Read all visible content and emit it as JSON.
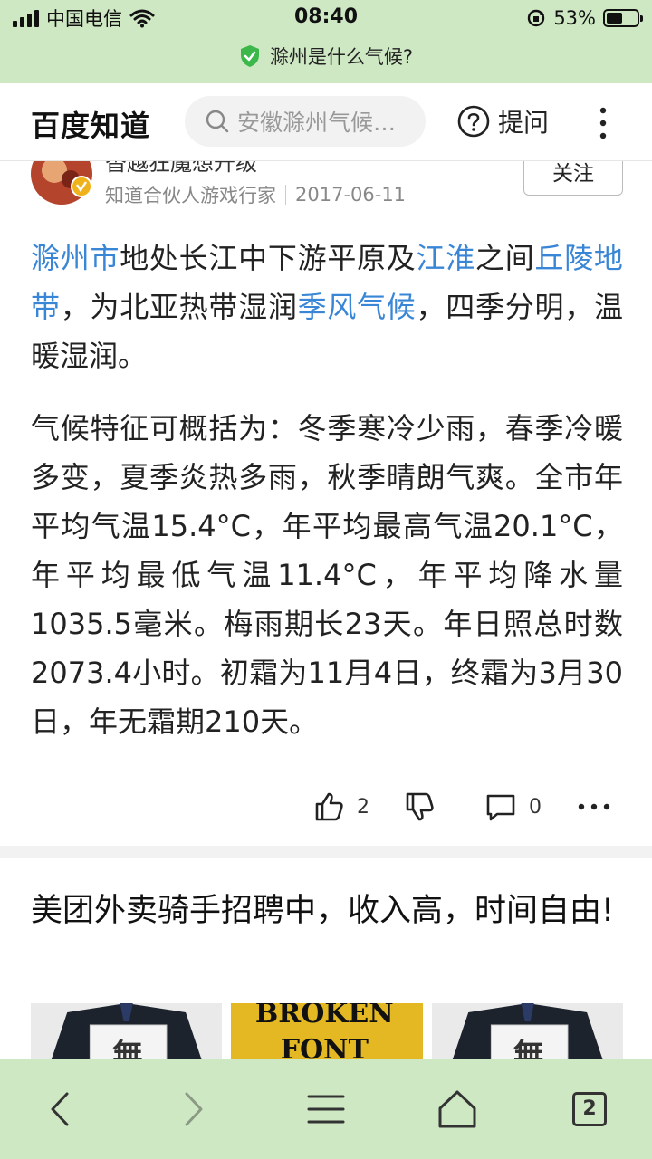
{
  "status_bar": {
    "carrier": "中国电信",
    "time": "08:40",
    "battery_text": "53%",
    "battery_level": 0.53
  },
  "url_bar": {
    "page_title": "滁州是什么气候?",
    "secure_icon": "shield-check-icon"
  },
  "header": {
    "logo": "百度知道",
    "search_placeholder": "安徽滁州气候…",
    "ask_label": "提问"
  },
  "answer": {
    "author_name": "杳越狂魔想升级",
    "author_role": "知道合伙人游戏行家",
    "date": "2017-06-11",
    "follow_label": "关注",
    "para1": [
      {
        "t": "滁州市",
        "link": true
      },
      {
        "t": "地处长江中下游平原及",
        "link": false
      },
      {
        "t": "江淮",
        "link": true
      },
      {
        "t": "之间",
        "link": false
      },
      {
        "t": "丘陵地带",
        "link": true
      },
      {
        "t": "，为北亚热带湿润",
        "link": false
      },
      {
        "t": "季风气候",
        "link": true
      },
      {
        "t": "，四季分明，温暖湿润。",
        "link": false
      }
    ],
    "para2": "气候特征可概括为：冬季寒冷少雨，春季冷暖多变，夏季炎热多雨，秋季晴朗气爽。全市年平均气温15.4°C，年平均最高气温20.1°C，年平均最低气温11.4°C，年平均降水量1035.5毫米。梅雨期长23天。年日照总时数2073.4小时。初霜为11月4日，终霜为3月30日，年无霜期210天。",
    "like_count": "2",
    "comment_count": "0"
  },
  "ad": {
    "title": "美团外卖骑手招聘中，收入高，时间自由!",
    "image_texts": [
      "無",
      "BROKEN FONT",
      "無"
    ]
  },
  "colors": {
    "link": "#3a86d6",
    "chrome_green": "#cfe8c4"
  },
  "bottom_bar": {
    "tabs_count": "2"
  }
}
